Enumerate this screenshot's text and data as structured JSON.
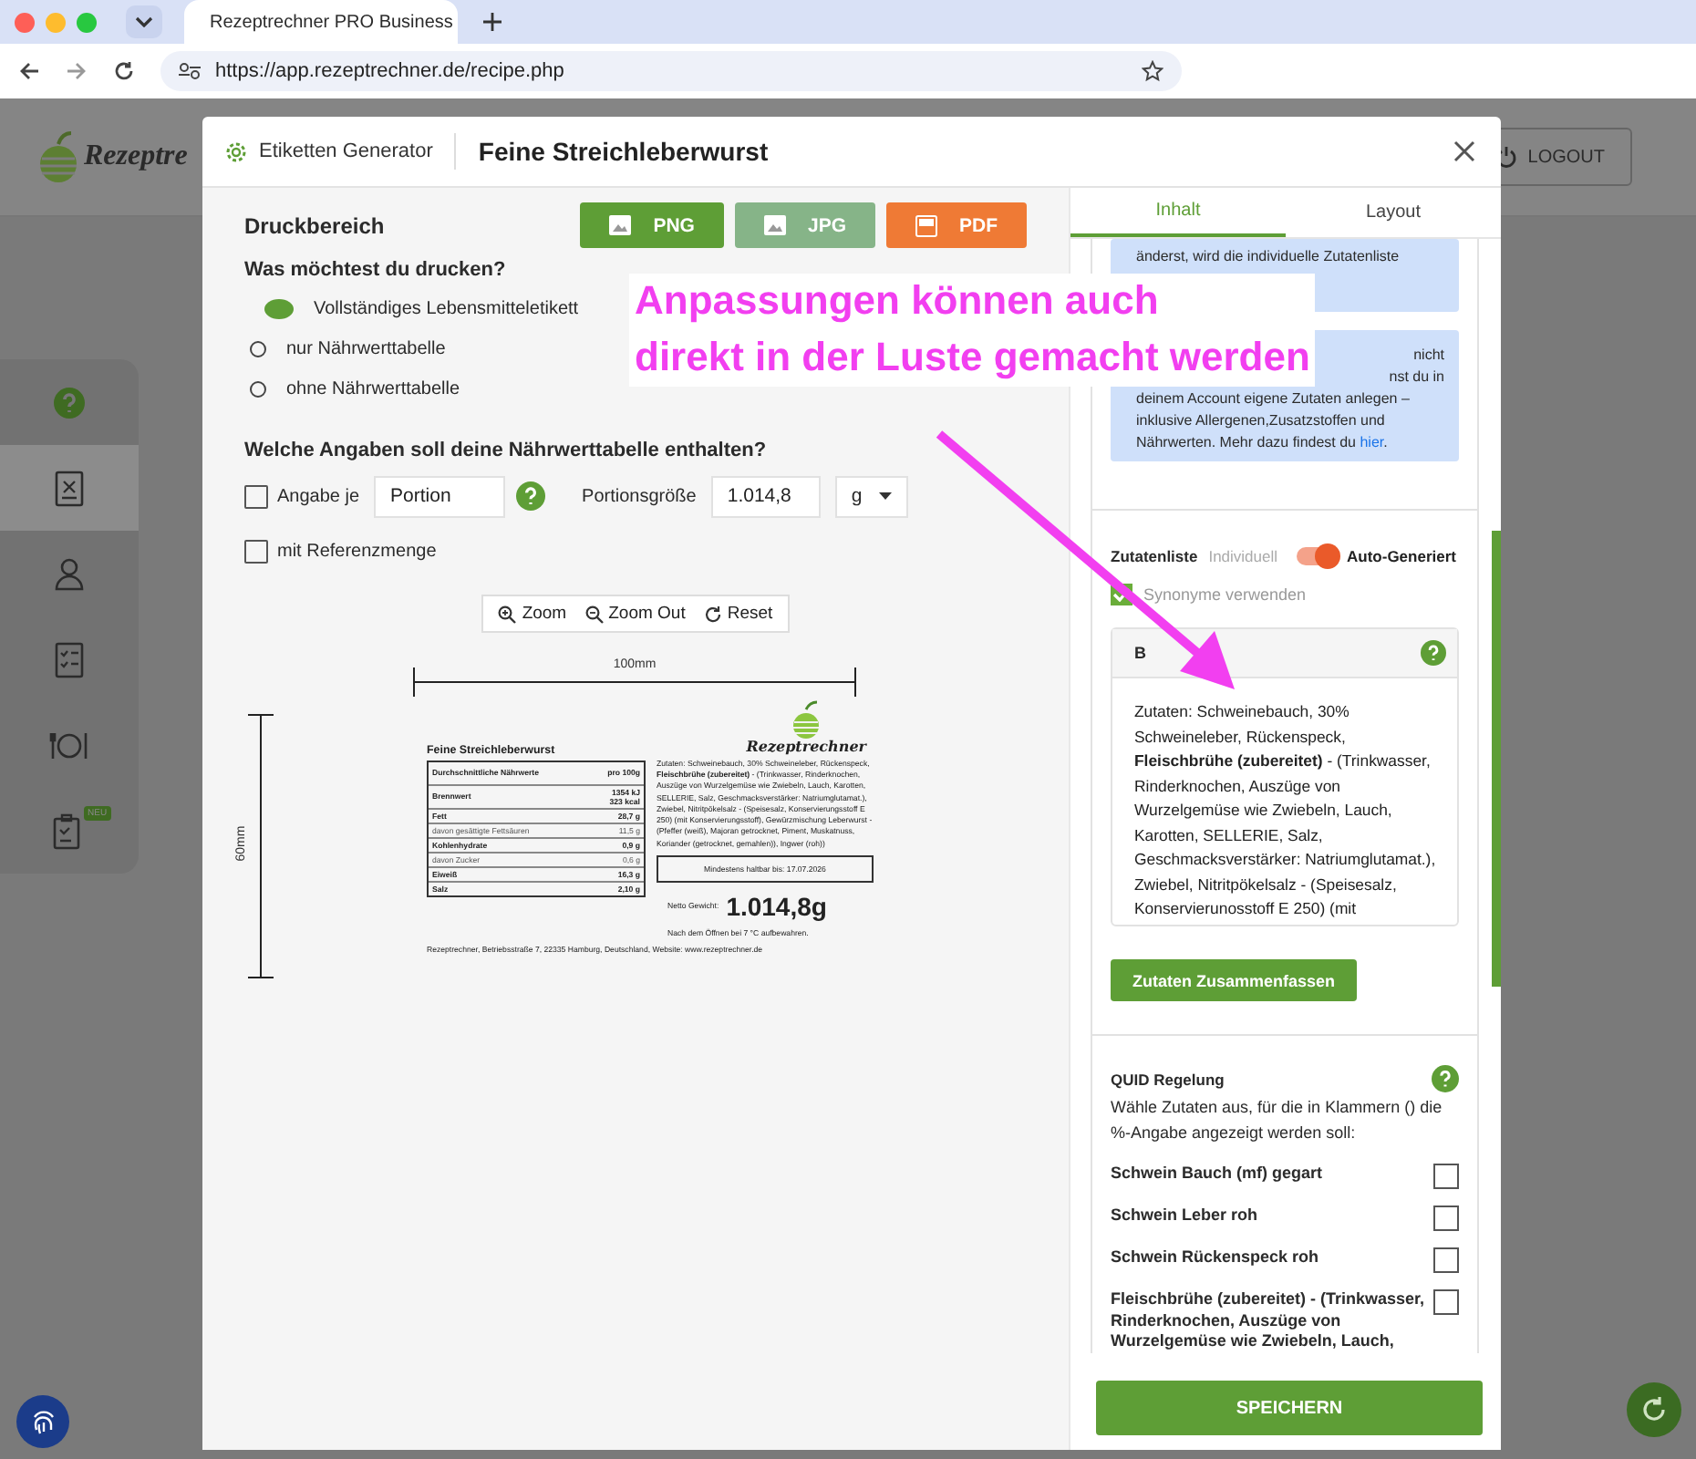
{
  "browser": {
    "tab_title": "Rezeptrechner PRO Business",
    "url": "https://app.rezeptrechner.de/recipe.php"
  },
  "app": {
    "logo_text": "Rezeptre",
    "logout": "LOGOUT",
    "sidebar": [
      {
        "kind": "help",
        "selected": false
      },
      {
        "kind": "recipe",
        "selected": true
      },
      {
        "kind": "user",
        "selected": false
      },
      {
        "kind": "checklist",
        "selected": false
      },
      {
        "kind": "dish",
        "selected": false
      },
      {
        "kind": "clipboard",
        "selected": false,
        "badge": "NEU"
      }
    ]
  },
  "modal": {
    "app_name": "Etiketten Generator",
    "title": "Feine Streichleberwurst"
  },
  "print_area": {
    "heading": "Druckbereich",
    "exports": [
      {
        "label": "PNG",
        "kind": "image",
        "color": "#5e9e36"
      },
      {
        "label": "JPG",
        "kind": "image",
        "color": "#86b488"
      },
      {
        "label": "PDF",
        "kind": "pdf",
        "color": "#ef7a35"
      }
    ],
    "question": "Was möchtest du drucken?",
    "options": [
      {
        "label": "Vollständiges Lebensmitteletikett",
        "selected": true
      },
      {
        "label": "nur Nährwerttabelle",
        "selected": false
      },
      {
        "label": "ohne Nährwerttabelle",
        "selected": false
      }
    ],
    "nutrition_question": "Welche Angaben soll deine Nährwerttabelle enthalten?",
    "per_portion": {
      "label": "Angabe je",
      "checked": false,
      "value": "Portion"
    },
    "portion_size": {
      "label": "Portionsgröße",
      "value": "1.014,8",
      "unit": "g"
    },
    "reference": {
      "label": "mit Referenzmenge",
      "checked": false
    },
    "zoom_buttons": [
      {
        "label": "Zoom",
        "kind": "zoom-in"
      },
      {
        "label": "Zoom Out",
        "kind": "zoom-out"
      },
      {
        "label": "Reset",
        "kind": "reset"
      }
    ]
  },
  "preview": {
    "width_label": "100mm",
    "height_label": "60mm",
    "logo_text": "Rezeptrechner",
    "title": "Feine Streichleberwurst",
    "nutrition": [
      {
        "name": "Durchschnittliche Nährwerte",
        "value": "pro 100g",
        "kind": "head"
      },
      {
        "name": "Brennwert",
        "value": "1354 kJ\n323 kcal",
        "kind": "main"
      },
      {
        "name": "Fett",
        "value": "28,7 g",
        "kind": "main"
      },
      {
        "name": "davon gesättigte Fettsäuren",
        "value": "11,5 g",
        "kind": "sub"
      },
      {
        "name": "Kohlenhydrate",
        "value": "0,9 g",
        "kind": "main"
      },
      {
        "name": "davon Zucker",
        "value": "0,6 g",
        "kind": "sub"
      },
      {
        "name": "Eiweiß",
        "value": "16,3 g",
        "kind": "main"
      },
      {
        "name": "Salz",
        "value": "2,10 g",
        "kind": "main"
      }
    ],
    "ingredients": "Zutaten: Schweinebauch, 30% Schweineleber, Rückenspeck, **Fleischbrühe (zubereitet)** - (Trinkwasser, Rinderknochen, Auszüge von Wurzelgemüse wie Zwiebeln, Lauch, Karotten, SELLERIE, Salz, Geschmacksverstärker: Natriumglutamat.), Zwiebel, Nitritpökelsalz - (Speisesalz, Konservierungsstoff E 250) (mit Konservierungsstoff), Gewürzmischung Leberwurst - (Pfeffer (weiß), Majoran getrocknet, Piment, Muskatnuss, Koriander (getrocknet, gemahlen)), Ingwer (roh))",
    "best_before": "Mindestens haltbar bis: 17.07.2026",
    "net_weight_label": "Netto Gewicht:",
    "net_weight": "1.014,8g",
    "storage": "Nach dem Öffnen bei 7 °C aufbewahren.",
    "footer": "Rezeptrechner, Betriebsstraße 7, 22335 Hamburg, Deutschland, Website: www.rezeptrechner.de"
  },
  "side_panel": {
    "tabs": [
      {
        "label": "Inhalt",
        "selected": true
      },
      {
        "label": "Layout",
        "selected": false
      }
    ],
    "info_top": "änderst, wird die individuelle Zutatenliste",
    "info_fragments": [
      "nicht",
      "nst du in"
    ],
    "info_text": "deinem Account eigene Zutaten anlegen – inklusive Allergenen,Zusatzstoffen und Nährwerten. Mehr dazu findest du",
    "info_link": "hier",
    "info_suffix": ".",
    "ingredient_list": {
      "label": "Zutatenliste",
      "left": "Individuell",
      "right": "Auto-Generiert",
      "on": true
    },
    "synonyms": {
      "label": "Synonyme verwenden",
      "checked": true
    },
    "ingredients_box": {
      "header": "B",
      "text": "Zutaten: Schweinebauch, 30% Schweineleber, Rückenspeck, **Fleischbrühe (zubereitet)** - (Trinkwasser, Rinderknochen, Auszüge von Wurzelgemüse wie Zwiebeln, Lauch, Karotten,  SELLERIE, Salz, Geschmacksverstärker: Natriumglutamat.), Zwiebel, Nitritpökelsalz - (Speisesalz, Konservierunosstoff E 250) (mit"
    },
    "summarize_button": "Zutaten Zusammenfassen",
    "quid": {
      "title": "QUID Regelung",
      "description": "Wähle Zutaten aus, für die in Klammern () die %-Angabe angezeigt werden soll:",
      "items": [
        {
          "label": "Schwein Bauch (mf) gegart",
          "checked": false
        },
        {
          "label": "Schwein Leber roh",
          "checked": false
        },
        {
          "label": "Schwein Rückenspeck roh",
          "checked": false
        },
        {
          "label": "Fleischbrühe (zubereitet) - (Trinkwasser, Rinderknochen, Auszüge von Wurzelgemüse wie Zwiebeln, Lauch,",
          "checked": false
        }
      ]
    },
    "save": "SPEICHERN"
  },
  "annotation": {
    "lines": [
      "Anpassungen können auch",
      "direkt in der Luste gemacht werden"
    ]
  }
}
